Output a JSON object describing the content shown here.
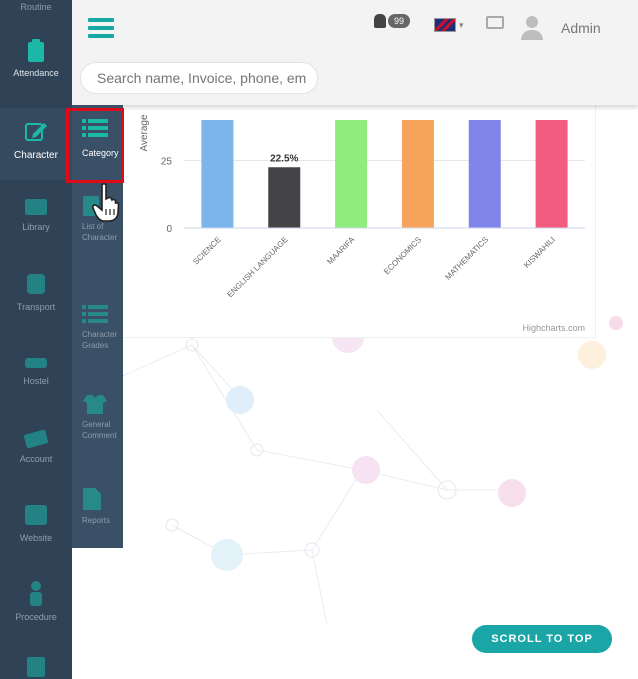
{
  "header": {
    "search_placeholder": "Search name, Invoice, phone, em",
    "notification_count": "99",
    "user_name": "Admin"
  },
  "sidebar": {
    "items": [
      {
        "label": "Routine",
        "icon": "calendar-icon"
      },
      {
        "label": "Attendance",
        "icon": "clipboard-icon"
      },
      {
        "label": "Character",
        "icon": "edit-icon"
      },
      {
        "label": "Library",
        "icon": "books-icon"
      },
      {
        "label": "Transport",
        "icon": "bus-icon"
      },
      {
        "label": "Hostel",
        "icon": "bed-icon"
      },
      {
        "label": "Account",
        "icon": "money-icon"
      },
      {
        "label": "Website",
        "icon": "monitor-icon"
      },
      {
        "label": "Procedure",
        "icon": "person-icon"
      }
    ]
  },
  "submenu": {
    "items": [
      {
        "label": "Category",
        "icon": "list-icon"
      },
      {
        "label": "List of Character",
        "icon": "document-icon"
      },
      {
        "label": "Character Grades",
        "icon": "list-icon"
      },
      {
        "label": "General Comment",
        "icon": "shirt-icon"
      },
      {
        "label": "Reports",
        "icon": "report-icon"
      }
    ]
  },
  "chart_data": {
    "type": "bar",
    "title": "",
    "ylabel": "Average",
    "ylim": [
      0,
      40
    ],
    "yticks": [
      0,
      25
    ],
    "categories": [
      "SCIENCE",
      "ENGLISH LANGUAGE",
      "MAARIFA",
      "ECONOMICS",
      "MATHEMATICS",
      "KISWAHILI"
    ],
    "series": [
      {
        "values": [
          40,
          22.5,
          40,
          40,
          40,
          40
        ]
      }
    ],
    "data_labels": [
      "",
      "22.5%",
      "",
      "",
      "",
      ""
    ],
    "colors": [
      "#7cb5ec",
      "#434348",
      "#90ed7d",
      "#f7a35c",
      "#8085e9",
      "#f15c80"
    ],
    "credits": "Highcharts.com"
  },
  "scroll_top": {
    "label": "SCROLL TO TOP"
  },
  "colors": {
    "sidebar": "#2f4256",
    "submenu": "#3a5067",
    "accent": "#17a8a4",
    "highlight": "#e00b18"
  }
}
